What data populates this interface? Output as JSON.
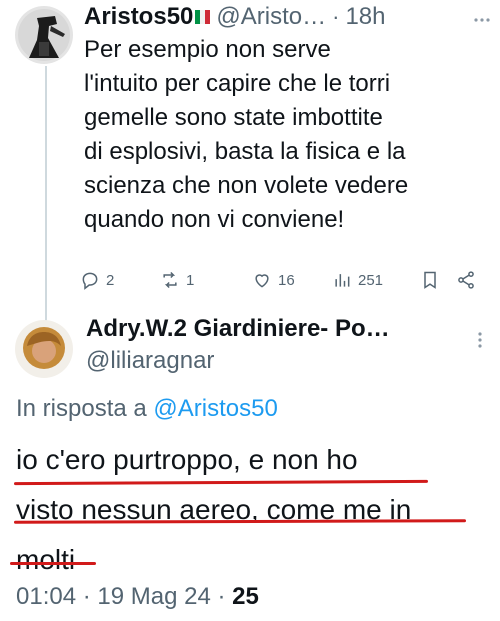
{
  "tweet1": {
    "author": "Aristos50",
    "handle": "@Aristo…",
    "separator": "·",
    "time": "18h",
    "text_lines": [
      "Per esempio non serve",
      "l'intuito per capire che le torri",
      "gemelle sono state imbottite",
      "di esplosivi, basta la fisica e la",
      "scienza che non volete vedere",
      "quando non vi conviene!"
    ],
    "actions": {
      "replies": "2",
      "reposts": "1",
      "likes": "16",
      "views": "251"
    }
  },
  "tweet2": {
    "author": "Adry.W.2 Giardiniere- Po…",
    "handle": "@liliaragnar",
    "reply_to_prefix": "In risposta a",
    "reply_to_handle": "@Aristos50",
    "text_lines": [
      "io c'ero purtroppo, e non ho",
      "visto nessun aereo, come me in",
      "molti"
    ],
    "timestamp": "01:04 · 19 Mag 24 ·",
    "views": "25"
  },
  "colors": {
    "link": "#1d9bf0",
    "muted": "#536471",
    "underline": "#d11a1a",
    "flag_green": "#009246",
    "flag_red": "#ce2b37"
  }
}
